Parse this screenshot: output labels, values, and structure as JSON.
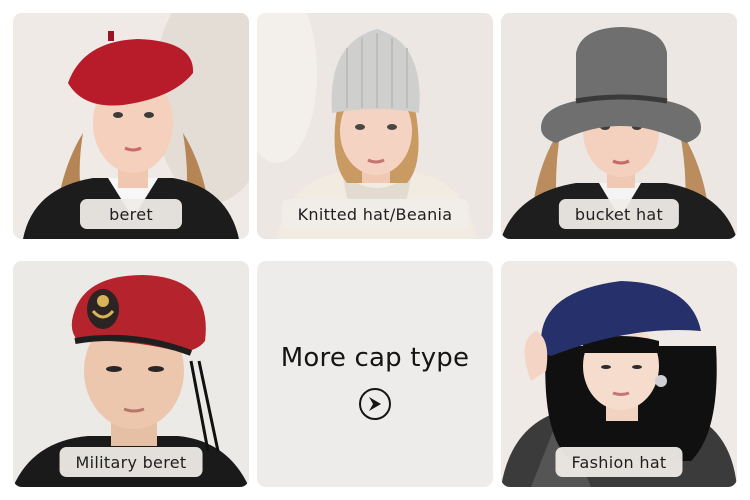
{
  "tiles": [
    {
      "label": "beret",
      "hat_color": "#b81c2a"
    },
    {
      "label": "Knitted hat/Beania",
      "hat_color": "#cfcfcd"
    },
    {
      "label": "bucket hat",
      "hat_color": "#6f6f6f"
    },
    {
      "label": "Military beret",
      "hat_color": "#b5232c"
    },
    {
      "label": "Fashion hat",
      "hat_color": "#26306a"
    }
  ],
  "more": {
    "title": "More cap type",
    "icon": "chevron-right-circle-icon"
  }
}
